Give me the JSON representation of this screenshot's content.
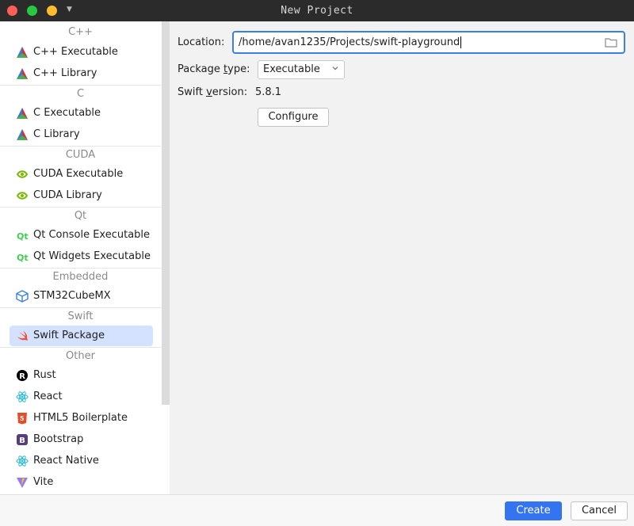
{
  "window": {
    "title": "New Project",
    "controls": {
      "close_color": "#ff5f57",
      "maximize_color": "#28c840",
      "minimize_color": "#febc2e"
    }
  },
  "sidebar": {
    "groups": [
      {
        "label": "C++",
        "items": [
          {
            "label": "C++ Executable",
            "icon": "cmake-icon"
          },
          {
            "label": "C++ Library",
            "icon": "cmake-icon"
          }
        ]
      },
      {
        "label": "C",
        "items": [
          {
            "label": "C Executable",
            "icon": "cmake-icon"
          },
          {
            "label": "C Library",
            "icon": "cmake-icon"
          }
        ]
      },
      {
        "label": "CUDA",
        "items": [
          {
            "label": "CUDA Executable",
            "icon": "nvidia-icon"
          },
          {
            "label": "CUDA Library",
            "icon": "nvidia-icon"
          }
        ]
      },
      {
        "label": "Qt",
        "items": [
          {
            "label": "Qt Console Executable",
            "icon": "qt-icon"
          },
          {
            "label": "Qt Widgets Executable",
            "icon": "qt-icon"
          }
        ]
      },
      {
        "label": "Embedded",
        "items": [
          {
            "label": "STM32CubeMX",
            "icon": "cube-icon"
          }
        ]
      },
      {
        "label": "Swift",
        "items": [
          {
            "label": "Swift Package",
            "icon": "swift-icon",
            "selected": true
          }
        ]
      },
      {
        "label": "Other",
        "items": [
          {
            "label": "Rust",
            "icon": "rust-icon"
          },
          {
            "label": "React",
            "icon": "react-icon"
          },
          {
            "label": "HTML5 Boilerplate",
            "icon": "html5-icon"
          },
          {
            "label": "Bootstrap",
            "icon": "bootstrap-icon"
          },
          {
            "label": "React Native",
            "icon": "react-icon"
          },
          {
            "label": "Vite",
            "icon": "vite-icon"
          }
        ]
      }
    ]
  },
  "form": {
    "location_label": "Location:",
    "location_value": "/home/avan1235/Projects/swift-playground",
    "package_type_label_pre": "Package ",
    "package_type_label_u": "t",
    "package_type_label_post": "ype:",
    "package_type_value": "Executable",
    "swift_version_label_pre": "Swift ",
    "swift_version_label_u": "v",
    "swift_version_label_post": "ersion:",
    "swift_version_value": "5.8.1",
    "configure_label": "Configure"
  },
  "footer": {
    "create_label": "Create",
    "cancel_label": "Cancel"
  },
  "colors": {
    "accent": "#3574f0",
    "selection": "#d4e2ff",
    "titlebar": "#2b2b2b"
  }
}
